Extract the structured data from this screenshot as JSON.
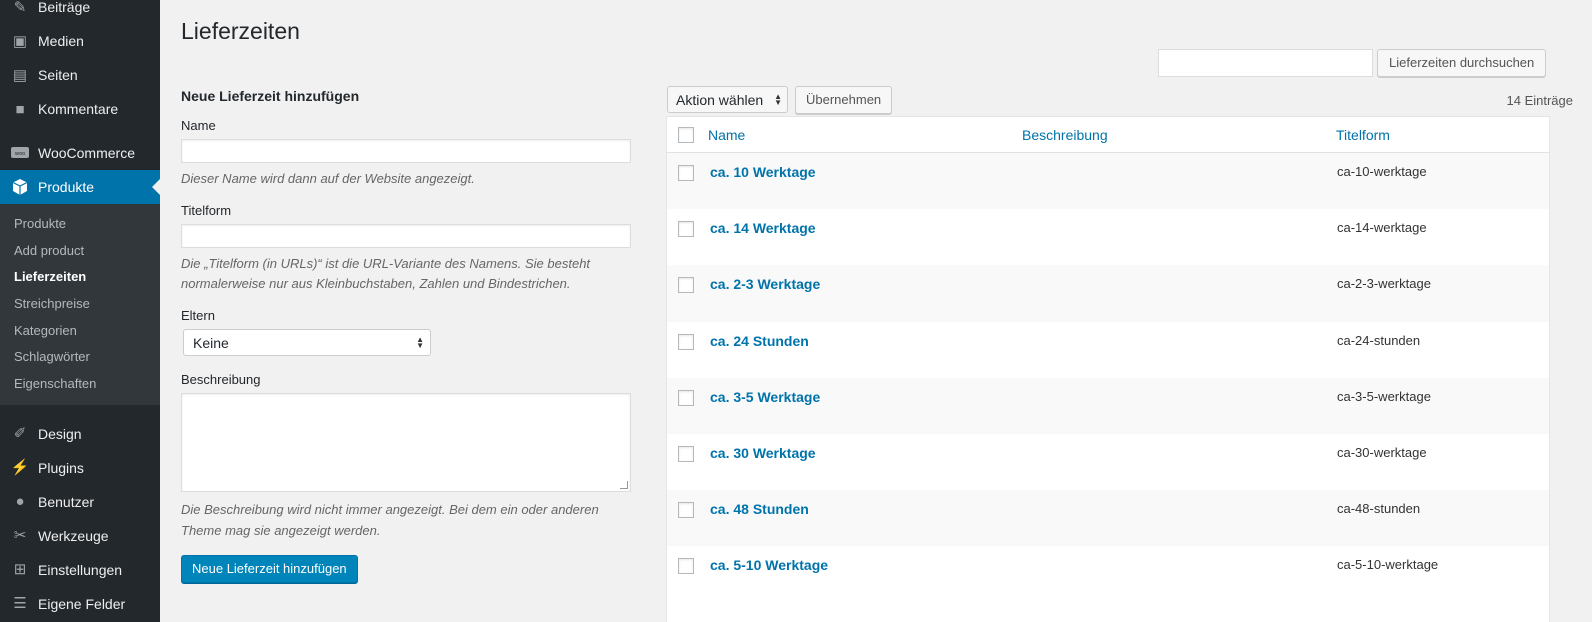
{
  "sidebar": {
    "items_top": [
      {
        "label": "Beiträge",
        "icon": "pin-icon"
      },
      {
        "label": "Medien",
        "icon": "media-icon"
      },
      {
        "label": "Seiten",
        "icon": "pages-icon"
      },
      {
        "label": "Kommentare",
        "icon": "comments-icon"
      }
    ],
    "woocommerce": {
      "label": "WooCommerce",
      "icon": "woo-icon"
    },
    "produkte": {
      "label": "Produkte",
      "icon": "box-icon"
    },
    "submenu": [
      "Produkte",
      "Add product",
      "Lieferzeiten",
      "Streichpreise",
      "Kategorien",
      "Schlagwörter",
      "Eigenschaften"
    ],
    "submenu_current": "Lieferzeiten",
    "items_bottom": [
      {
        "label": "Design",
        "icon": "brush-icon"
      },
      {
        "label": "Plugins",
        "icon": "plugin-icon"
      },
      {
        "label": "Benutzer",
        "icon": "user-icon"
      },
      {
        "label": "Werkzeuge",
        "icon": "wrench-icon"
      },
      {
        "label": "Einstellungen",
        "icon": "settings-icon"
      },
      {
        "label": "Eigene Felder",
        "icon": "fields-icon"
      }
    ]
  },
  "page": {
    "title": "Lieferzeiten"
  },
  "form": {
    "heading": "Neue Lieferzeit hinzufügen",
    "name_label": "Name",
    "name_value": "",
    "name_desc": "Dieser Name wird dann auf der Website angezeigt.",
    "slug_label": "Titelform",
    "slug_value": "",
    "slug_desc": "Die „Titelform (in URLs)“ ist die URL-Variante des Namens. Sie besteht normalerweise nur aus Kleinbuchstaben, Zahlen und Bindestrichen.",
    "parent_label": "Eltern",
    "parent_selected": "Keine",
    "desc_label": "Beschreibung",
    "desc_value": "",
    "desc_desc": "Die Beschreibung wird nicht immer angezeigt. Bei dem ein oder anderen Theme mag sie angezeigt werden.",
    "submit_label": "Neue Lieferzeit hinzufügen"
  },
  "search": {
    "value": "",
    "button_label": "Lieferzeiten durchsuchen"
  },
  "bulk": {
    "selected": "Aktion wählen",
    "apply_label": "Übernehmen"
  },
  "count": "14 Einträge",
  "table": {
    "headers": {
      "name": "Name",
      "description": "Beschreibung",
      "slug": "Titelform"
    },
    "rows": [
      {
        "name": "ca. 10 Werktage",
        "description": "",
        "slug": "ca-10-werktage"
      },
      {
        "name": "ca. 14 Werktage",
        "description": "",
        "slug": "ca-14-werktage"
      },
      {
        "name": "ca. 2-3 Werktage",
        "description": "",
        "slug": "ca-2-3-werktage"
      },
      {
        "name": "ca. 24 Stunden",
        "description": "",
        "slug": "ca-24-stunden"
      },
      {
        "name": "ca. 3-5 Werktage",
        "description": "",
        "slug": "ca-3-5-werktage"
      },
      {
        "name": "ca. 30 Werktage",
        "description": "",
        "slug": "ca-30-werktage"
      },
      {
        "name": "ca. 48 Stunden",
        "description": "",
        "slug": "ca-48-stunden"
      },
      {
        "name": "ca. 5-10 Werktage",
        "description": "",
        "slug": "ca-5-10-werktage"
      }
    ]
  },
  "colors": {
    "sidebar_bg": "#23282d",
    "active": "#0073aa",
    "link": "#0073aa",
    "primary_button": "#0085ba"
  }
}
